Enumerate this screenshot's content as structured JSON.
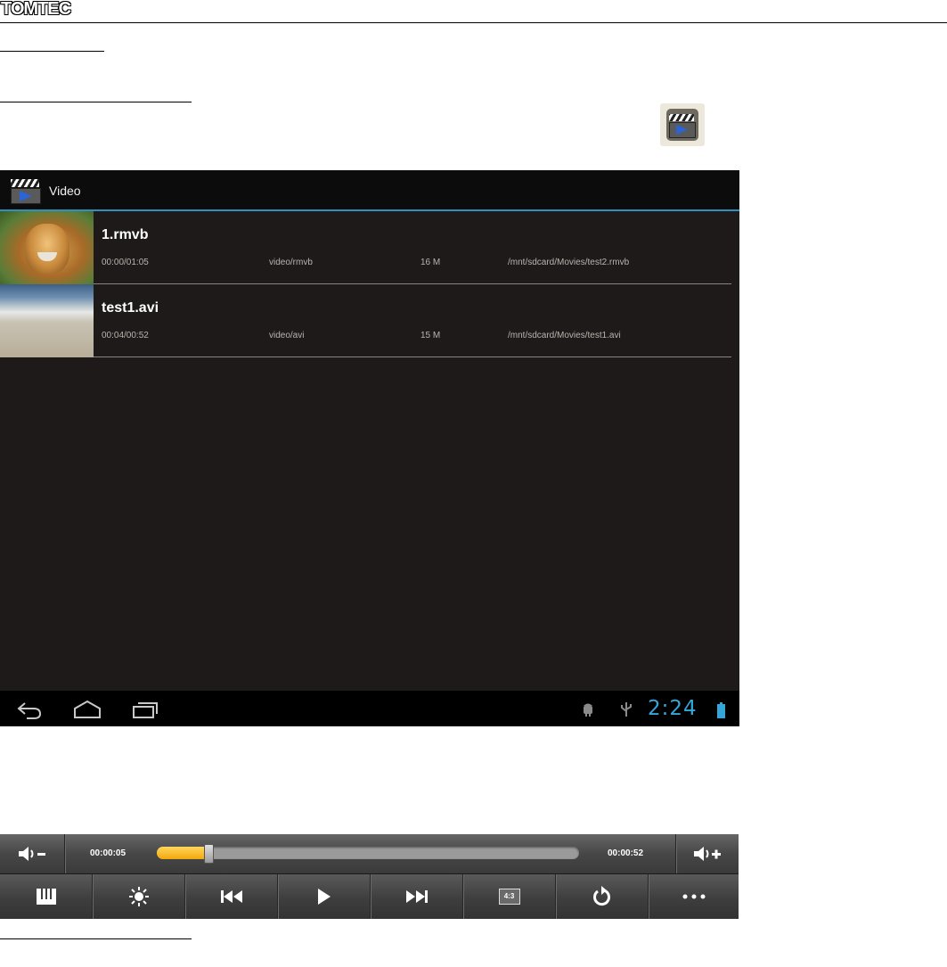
{
  "document": {
    "logo_text": "TOMTEC"
  },
  "app": {
    "title": "Video",
    "icon": "clapperboard-icon"
  },
  "videos": [
    {
      "name": "1.rmvb",
      "time": "00:00/01:05",
      "type": "video/rmvb",
      "size": "16 M",
      "path": "/mnt/sdcard/Movies/test2.rmvb",
      "thumbnail": "lion-cartoon"
    },
    {
      "name": "test1.avi",
      "time": "00:04/00:52",
      "type": "video/avi",
      "size": "15 M",
      "path": "/mnt/sdcard/Movies/test1.avi",
      "thumbnail": "beach-waves"
    }
  ],
  "navbar": {
    "clock": "2:24",
    "clock_color": "#34a7d8",
    "icons": [
      "back-icon",
      "home-icon",
      "recent-apps-icon",
      "android-debug-icon",
      "usb-icon",
      "battery-icon"
    ]
  },
  "player": {
    "current_time": "00:00:05",
    "total_time": "00:00:52",
    "progress_fraction": 0.12,
    "progress_color": "#f5b21a",
    "aspect_label": "4:3",
    "buttons": [
      "volume-down",
      "volume-up",
      "playlist",
      "brightness",
      "previous",
      "play",
      "next",
      "aspect-ratio",
      "repeat",
      "more"
    ]
  }
}
